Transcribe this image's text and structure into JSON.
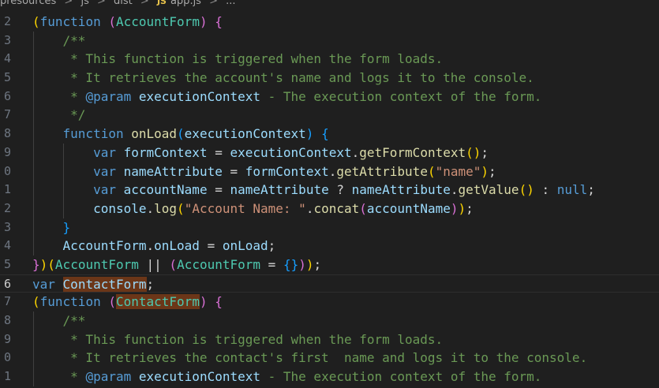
{
  "breadcrumb": {
    "items": [
      "presources",
      "js",
      "dist",
      "app.js",
      "..."
    ],
    "file_icon_label": "JS",
    "separator": ">"
  },
  "colors": {
    "background": "#1f1f1f",
    "keyword": "#569cd6",
    "function": "#dcdcaa",
    "variable": "#9cdcfe",
    "string": "#ce9178",
    "comment": "#6a9955",
    "highlight": "#6b3618"
  },
  "editor": {
    "current_line": "6",
    "lines": [
      {
        "num": "2",
        "indent": 0,
        "tokens": [
          {
            "c": "p1",
            "t": "("
          },
          {
            "c": "kw",
            "t": "function"
          },
          {
            "c": "op",
            "t": " "
          },
          {
            "c": "p2",
            "t": "("
          },
          {
            "c": "ty",
            "t": "AccountForm"
          },
          {
            "c": "p2",
            "t": ")"
          },
          {
            "c": "op",
            "t": " "
          },
          {
            "c": "p2",
            "t": "{"
          }
        ]
      },
      {
        "num": "3",
        "indent": 1,
        "tokens": [
          {
            "c": "cm",
            "t": "    /**"
          }
        ]
      },
      {
        "num": "4",
        "indent": 1,
        "tokens": [
          {
            "c": "cm",
            "t": "     * This function is triggered when the form loads."
          }
        ]
      },
      {
        "num": "5",
        "indent": 1,
        "tokens": [
          {
            "c": "cm",
            "t": "     * It retrieves the account's name and logs it to the console."
          }
        ]
      },
      {
        "num": "6",
        "indent": 1,
        "tokens": [
          {
            "c": "cm",
            "t": "     * "
          },
          {
            "c": "doc",
            "t": "@param"
          },
          {
            "c": "cm",
            "t": " "
          },
          {
            "c": "id",
            "t": "executionContext"
          },
          {
            "c": "cm",
            "t": " - The execution context of the form."
          }
        ]
      },
      {
        "num": "7",
        "indent": 1,
        "tokens": [
          {
            "c": "cm",
            "t": "     */"
          }
        ]
      },
      {
        "num": "8",
        "indent": 1,
        "tokens": [
          {
            "c": "op",
            "t": "    "
          },
          {
            "c": "kw",
            "t": "function"
          },
          {
            "c": "op",
            "t": " "
          },
          {
            "c": "fn",
            "t": "onLoad"
          },
          {
            "c": "p3",
            "t": "("
          },
          {
            "c": "id",
            "t": "executionContext"
          },
          {
            "c": "p3",
            "t": ")"
          },
          {
            "c": "op",
            "t": " "
          },
          {
            "c": "p3",
            "t": "{"
          }
        ]
      },
      {
        "num": "9",
        "indent": 2,
        "tokens": [
          {
            "c": "op",
            "t": "        "
          },
          {
            "c": "kw",
            "t": "var"
          },
          {
            "c": "op",
            "t": " "
          },
          {
            "c": "id",
            "t": "formContext"
          },
          {
            "c": "op",
            "t": " = "
          },
          {
            "c": "id",
            "t": "executionContext"
          },
          {
            "c": "op",
            "t": "."
          },
          {
            "c": "fn",
            "t": "getFormContext"
          },
          {
            "c": "p1",
            "t": "()"
          },
          {
            "c": "op",
            "t": ";"
          }
        ]
      },
      {
        "num": "0",
        "indent": 2,
        "tokens": [
          {
            "c": "op",
            "t": "        "
          },
          {
            "c": "kw",
            "t": "var"
          },
          {
            "c": "op",
            "t": " "
          },
          {
            "c": "id",
            "t": "nameAttribute"
          },
          {
            "c": "op",
            "t": " = "
          },
          {
            "c": "id",
            "t": "formContext"
          },
          {
            "c": "op",
            "t": "."
          },
          {
            "c": "fn",
            "t": "getAttribute"
          },
          {
            "c": "p1",
            "t": "("
          },
          {
            "c": "str",
            "t": "\"name\""
          },
          {
            "c": "p1",
            "t": ")"
          },
          {
            "c": "op",
            "t": ";"
          }
        ]
      },
      {
        "num": "1",
        "indent": 2,
        "tokens": [
          {
            "c": "op",
            "t": "        "
          },
          {
            "c": "kw",
            "t": "var"
          },
          {
            "c": "op",
            "t": " "
          },
          {
            "c": "id",
            "t": "accountName"
          },
          {
            "c": "op",
            "t": " = "
          },
          {
            "c": "id",
            "t": "nameAttribute"
          },
          {
            "c": "op",
            "t": " ? "
          },
          {
            "c": "id",
            "t": "nameAttribute"
          },
          {
            "c": "op",
            "t": "."
          },
          {
            "c": "fn",
            "t": "getValue"
          },
          {
            "c": "p1",
            "t": "()"
          },
          {
            "c": "op",
            "t": " : "
          },
          {
            "c": "kw",
            "t": "null"
          },
          {
            "c": "op",
            "t": ";"
          }
        ]
      },
      {
        "num": "2",
        "indent": 2,
        "tokens": [
          {
            "c": "op",
            "t": "        "
          },
          {
            "c": "id",
            "t": "console"
          },
          {
            "c": "op",
            "t": "."
          },
          {
            "c": "fn",
            "t": "log"
          },
          {
            "c": "p1",
            "t": "("
          },
          {
            "c": "str",
            "t": "\"Account Name: \""
          },
          {
            "c": "op",
            "t": "."
          },
          {
            "c": "fn",
            "t": "concat"
          },
          {
            "c": "p2",
            "t": "("
          },
          {
            "c": "id",
            "t": "accountName"
          },
          {
            "c": "p2",
            "t": ")"
          },
          {
            "c": "p1",
            "t": ")"
          },
          {
            "c": "op",
            "t": ";"
          }
        ]
      },
      {
        "num": "3",
        "indent": 1,
        "tokens": [
          {
            "c": "op",
            "t": "    "
          },
          {
            "c": "p3",
            "t": "}"
          }
        ]
      },
      {
        "num": "4",
        "indent": 1,
        "tokens": [
          {
            "c": "op",
            "t": "    "
          },
          {
            "c": "id",
            "t": "AccountForm"
          },
          {
            "c": "op",
            "t": "."
          },
          {
            "c": "id",
            "t": "onLoad"
          },
          {
            "c": "op",
            "t": " = "
          },
          {
            "c": "id",
            "t": "onLoad"
          },
          {
            "c": "op",
            "t": ";"
          }
        ]
      },
      {
        "num": "5",
        "indent": 0,
        "tokens": [
          {
            "c": "p2",
            "t": "}"
          },
          {
            "c": "p1",
            "t": ")"
          },
          {
            "c": "p1",
            "t": "("
          },
          {
            "c": "ty",
            "t": "AccountForm"
          },
          {
            "c": "op",
            "t": " || "
          },
          {
            "c": "p2",
            "t": "("
          },
          {
            "c": "ty",
            "t": "AccountForm"
          },
          {
            "c": "op",
            "t": " = "
          },
          {
            "c": "p3",
            "t": "{}"
          },
          {
            "c": "p2",
            "t": ")"
          },
          {
            "c": "p1",
            "t": ")"
          },
          {
            "c": "op",
            "t": ";"
          }
        ]
      },
      {
        "num": "6",
        "indent": 0,
        "current": true,
        "tokens": [
          {
            "c": "kw",
            "t": "var"
          },
          {
            "c": "op",
            "t": " "
          },
          {
            "c": "id hl",
            "t": "ContactForm"
          },
          {
            "c": "op",
            "t": ";"
          }
        ]
      },
      {
        "num": "7",
        "indent": 0,
        "tokens": [
          {
            "c": "p1",
            "t": "("
          },
          {
            "c": "kw",
            "t": "function"
          },
          {
            "c": "op",
            "t": " "
          },
          {
            "c": "p2",
            "t": "("
          },
          {
            "c": "ty hl",
            "t": "ContactForm"
          },
          {
            "c": "p2",
            "t": ")"
          },
          {
            "c": "op",
            "t": " "
          },
          {
            "c": "p2",
            "t": "{"
          }
        ]
      },
      {
        "num": "8",
        "indent": 1,
        "tokens": [
          {
            "c": "cm",
            "t": "    /**"
          }
        ]
      },
      {
        "num": "9",
        "indent": 1,
        "tokens": [
          {
            "c": "cm",
            "t": "     * This function is triggered when the form loads."
          }
        ]
      },
      {
        "num": "0",
        "indent": 1,
        "tokens": [
          {
            "c": "cm",
            "t": "     * It retrieves the contact's first  name and logs it to the console."
          }
        ]
      },
      {
        "num": "1",
        "indent": 1,
        "tokens": [
          {
            "c": "cm",
            "t": "     * "
          },
          {
            "c": "doc",
            "t": "@param"
          },
          {
            "c": "cm",
            "t": " "
          },
          {
            "c": "id",
            "t": "executionContext"
          },
          {
            "c": "cm",
            "t": " - The execution context of the form."
          }
        ]
      }
    ]
  }
}
